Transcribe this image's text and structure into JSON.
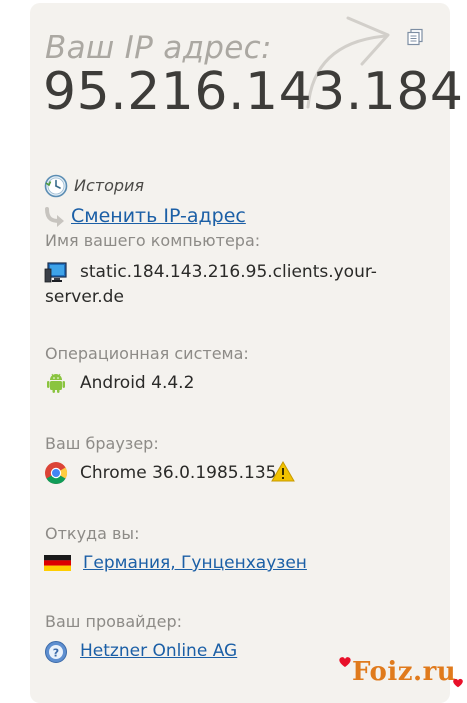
{
  "header": {
    "ip_caption": "Ваш IP адрес:",
    "ip_address": "95.216.143.184"
  },
  "actions": {
    "history_label": "История",
    "change_ip_label": "Сменить IP-адрес"
  },
  "computer": {
    "label": "Имя вашего компьютера:",
    "hostname": "static.184.143.216.95.clients.your-server.de"
  },
  "os": {
    "label": "Операционная система:",
    "value": "Android 4.4.2"
  },
  "browser": {
    "label": "Ваш браузер:",
    "value": "Chrome 36.0.1985.135"
  },
  "location": {
    "label": "Откуда вы:",
    "value": "Германия, Гунценхаузен"
  },
  "provider": {
    "label": "Ваш провайдер:",
    "value": "Hetzner Online AG"
  },
  "watermark": {
    "text": "Foiz.ru"
  },
  "icons": {
    "copy": "copy-icon",
    "history": "clock-icon",
    "change_ip": "redirect-arrow-icon",
    "computer": "monitor-icon",
    "os": "android-icon",
    "browser": "chrome-icon",
    "warning": "warning-icon",
    "flag": "germany-flag-icon",
    "provider": "help-globe-icon"
  },
  "colors": {
    "card_background": "#f4f2ee",
    "link": "#1b5fa6",
    "ip_text": "#3d3c39",
    "watermark": "#e07a1c",
    "warning": "#f2c200"
  }
}
